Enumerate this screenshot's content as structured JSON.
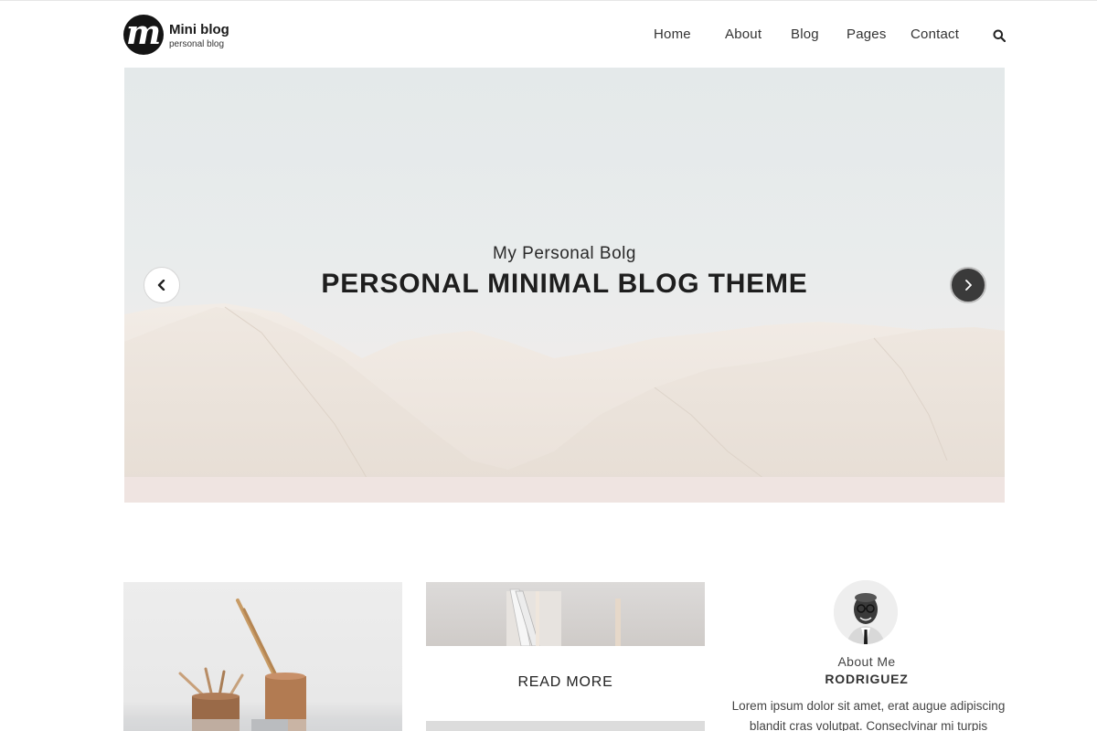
{
  "header": {
    "logo_letter": "m",
    "logo_title": "Mini blog",
    "logo_tagline": "personal blog",
    "nav": [
      {
        "label": "Home"
      },
      {
        "label": "About"
      },
      {
        "label": "Blog"
      },
      {
        "label": "Pages"
      },
      {
        "label": "Contact"
      }
    ],
    "search_icon": "search-icon"
  },
  "hero": {
    "subtitle": "My Personal Bolg",
    "title": "PERSONAL MINIMAL BLOG THEME",
    "prev_icon": "chevron-left-icon",
    "next_icon": "chevron-right-icon"
  },
  "posts": {
    "read_more_label": "READ MORE"
  },
  "about": {
    "label": "About Me",
    "name": "RODRIGUEZ",
    "text": "Lorem ipsum dolor sit amet, erat augue adipiscing blandit cras volutpat. Conseclvinar mi turpis"
  },
  "colors": {
    "accent_dark": "#1e1e1e",
    "hero_sky": "#e6eaeb",
    "hero_mountain": "#ece4dc"
  }
}
